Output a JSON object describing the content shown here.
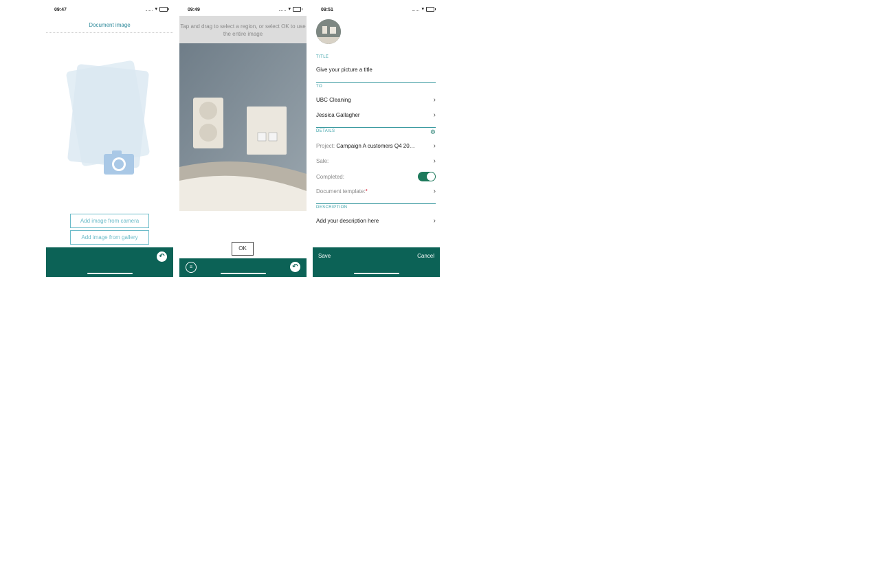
{
  "screens": [
    {
      "time": "09:47",
      "title": "Document image",
      "buttons": {
        "camera": "Add image from camera",
        "gallery": "Add image from gallery"
      }
    },
    {
      "time": "09:49",
      "hint": "Tap and drag to select a region, or select OK to use the entire image",
      "ok": "OK"
    },
    {
      "time": "09:51",
      "sections": {
        "title": "TITLE",
        "to": "TO",
        "details": "DETAILS",
        "description": "DESCRIPTION"
      },
      "title_placeholder": "Give your picture a title",
      "to_items": [
        "UBC Cleaning",
        "Jessica Gallagher"
      ],
      "details": {
        "project_label": "Project:",
        "project_value": "Campaign A customers Q4 20…",
        "sale_label": "Sale:",
        "completed_label": "Completed:",
        "completed": true,
        "template_label": "Document template:",
        "required_mark": "*"
      },
      "description_placeholder": "Add your description here",
      "footer": {
        "save": "Save",
        "cancel": "Cancel"
      }
    }
  ],
  "colors": {
    "accent": "#0c6256",
    "link": "#6bbbc9",
    "section": "#39a0a7"
  },
  "icons": [
    "wifi-icon",
    "battery-icon",
    "camera-icon",
    "undo-icon",
    "menu-icon",
    "chevron-right-icon",
    "gear-icon"
  ]
}
